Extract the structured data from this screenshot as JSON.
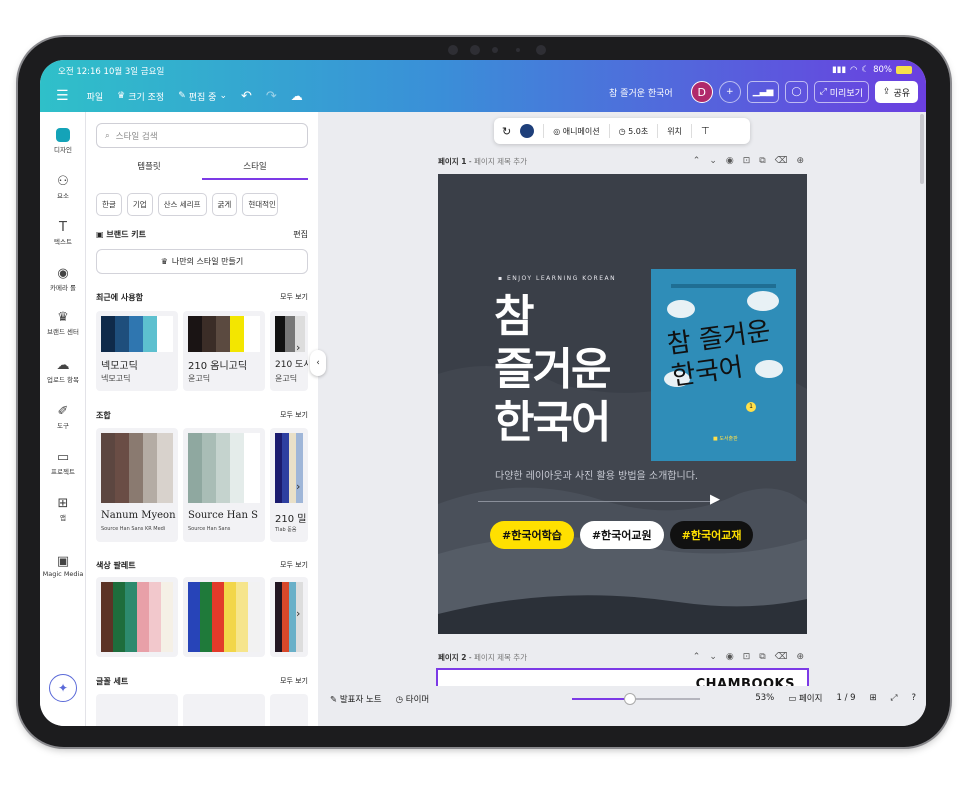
{
  "status": {
    "time_date": "오전 12:16  10월 3일 금요일",
    "battery": "80%"
  },
  "menu": {
    "file": "파일",
    "resize": "크기 조정",
    "editing": "편집 중"
  },
  "header": {
    "doc_title": "참 즐거운 한국어",
    "avatar": "D",
    "preview": "미리보기",
    "share": "공유"
  },
  "sidebar": {
    "items": [
      {
        "label": "디자인",
        "icon": "design-icon"
      },
      {
        "label": "요소",
        "icon": "elements-icon"
      },
      {
        "label": "텍스트",
        "icon": "text-icon"
      },
      {
        "label": "카메라 롤",
        "icon": "camera-icon"
      },
      {
        "label": "브랜드 센터",
        "icon": "brand-icon"
      },
      {
        "label": "업로드 항목",
        "icon": "upload-icon"
      },
      {
        "label": "도구",
        "icon": "draw-icon"
      },
      {
        "label": "프로젝트",
        "icon": "folder-icon"
      },
      {
        "label": "앱",
        "icon": "apps-icon"
      },
      {
        "label": "Magic Media",
        "icon": "magic-media-icon"
      }
    ]
  },
  "panel": {
    "search_placeholder": "스타일 검색",
    "tabs": [
      "템플릿",
      "스타일"
    ],
    "chips": [
      "한글",
      "기업",
      "산스 세리프",
      "굵게",
      "현대적인"
    ],
    "brand_kit": "브랜드 키트",
    "edit": "편집",
    "make_style": "나만의 스타일 만들기",
    "recent": "최근에 사용함",
    "see_all": "모두 보기",
    "recent_cards": [
      {
        "line1": "넥모고딕",
        "line2": "넥모고딕",
        "colors": [
          "#0f2a4a",
          "#1e4e7c",
          "#2f76b0",
          "#5dc0cf",
          "#ffffff"
        ]
      },
      {
        "line1": "210 옴니고딕",
        "line2": "윤고딕",
        "colors": [
          "#1a1414",
          "#3b2d27",
          "#5b4a40",
          "#f3e600",
          "#ffffff"
        ]
      },
      {
        "line1": "210 도시",
        "line2": "윤고딕",
        "colors": [
          "#111111",
          "#777777",
          "#dddddd"
        ]
      }
    ],
    "combination": "조합",
    "combo_cards": [
      {
        "font1": "Nanum Myeon",
        "font2": "Source Han Sans KR Medi",
        "colors": [
          "#5c4640",
          "#6a4d45",
          "#8a7a70",
          "#b4aca4",
          "#d8d2cc"
        ]
      },
      {
        "font1": "Source Han S",
        "font2": "Source Han Sans",
        "colors": [
          "#8fa8a0",
          "#a9bdb6",
          "#c5d3ce",
          "#e4ecea",
          "#ffffff"
        ]
      },
      {
        "font1": "210 밀",
        "font2": "Tlab 돋움",
        "colors": [
          "#1b1b6e",
          "#2e3fa0",
          "#e9e0c8",
          "#9fb6d8"
        ]
      }
    ],
    "palette": "색상 팔레트",
    "palette_cards": [
      {
        "colors": [
          "#5c3326",
          "#1e6d3c",
          "#2d8a6e",
          "#e8a0a8",
          "#f2c8cc",
          "#f5f0e6"
        ]
      },
      {
        "colors": [
          "#2744b8",
          "#1f7a3a",
          "#e23a2a",
          "#f2d64a",
          "#f6e58c",
          "#f2f2f2"
        ]
      },
      {
        "colors": [
          "#221622",
          "#d8482a",
          "#6ab0c8",
          "#dddddd"
        ]
      }
    ],
    "font_sets": "글꼴 세트"
  },
  "toolbar": {
    "animation": "애니메이션",
    "duration": "5.0초",
    "position": "위치",
    "color": "#1e3f7a"
  },
  "page1": {
    "label": "페이지 1",
    "add_title": "페이지 제목 추가"
  },
  "page2": {
    "label": "페이지 2",
    "add_title": "페이지 제목 추가",
    "brand": "CHAMBOOKS"
  },
  "slide": {
    "eyebrow": "▪ ENJOY LEARNING KOREAN",
    "title": [
      "참",
      "즐거운",
      "한국어"
    ],
    "subtitle": "다양한 레이아웃과 사진 활용 방법을 소개합니다.",
    "tags": [
      "#한국어학습",
      "#한국어교원",
      "#한국어교재"
    ],
    "book_title": "참 즐거운 한국어",
    "book_number": "1",
    "book_publisher": "■ 도서출판"
  },
  "bottom": {
    "notes": "발표자 노트",
    "timer": "타이머",
    "zoom": "53%",
    "pages": "페이지",
    "page_count": "1 / 9",
    "zoom_level": 0.45
  }
}
